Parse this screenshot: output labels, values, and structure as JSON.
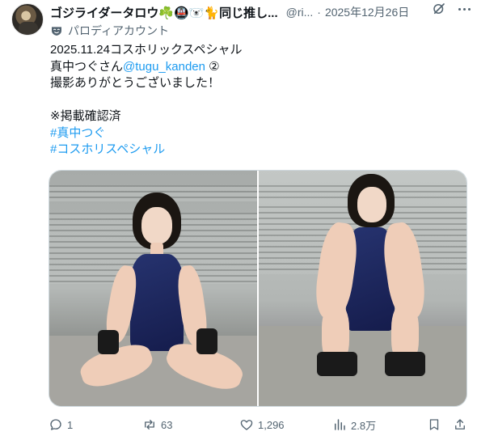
{
  "user": {
    "name": "ゴジライダータロウ☘️🚇🐻‍❄️🐈同じ推し...",
    "handle": "@ri...",
    "separator": "·",
    "date": "2025年12月26日",
    "label": "パロディアカウント"
  },
  "post": {
    "line1": "2025.11.24コスホリックスペシャル",
    "line2_prefix": "真中つぐさん",
    "mention": "@tugu_kanden",
    "line2_suffix": " ②",
    "line3": "撮影ありがとうございました！",
    "line4": "※掲載確認済",
    "hashtag1": "#真中つぐ",
    "hashtag2": "#コスホリスペシャル"
  },
  "media": {
    "photos": [
      {
        "icon": "photo-cosplayer-sitting-icon"
      },
      {
        "icon": "photo-cosplayer-knees-up-icon"
      }
    ]
  },
  "actions": {
    "replies": "1",
    "reposts": "63",
    "likes": "1,296",
    "views": "2.8万"
  },
  "icons": {
    "grok": "grok-icon",
    "more": "more-icon",
    "parody": "parody-mask-icon",
    "reply": "reply-icon",
    "repost": "repost-icon",
    "like": "heart-icon",
    "views": "views-icon",
    "bookmark": "bookmark-icon",
    "share": "share-icon"
  },
  "colors": {
    "link": "#1d9bf0",
    "muted": "#536471",
    "text": "#0f1419"
  }
}
